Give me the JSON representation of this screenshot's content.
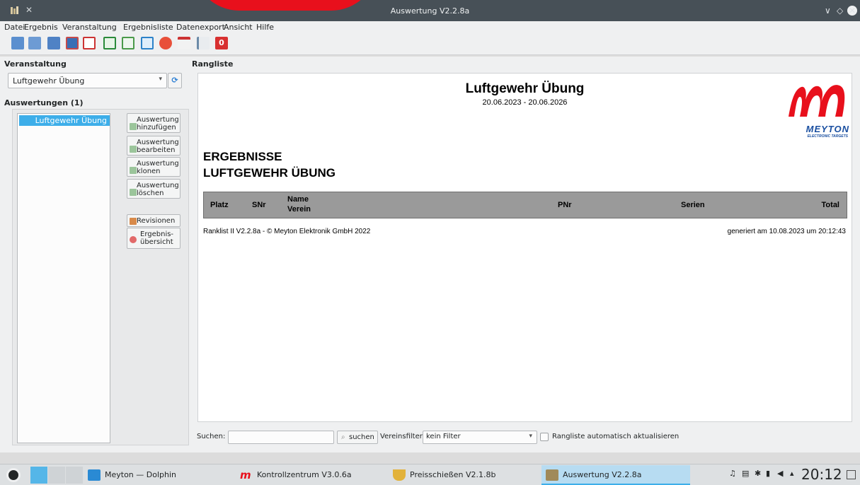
{
  "window": {
    "title": "Auswertung V2.2.8a"
  },
  "menu": [
    "Datei",
    "Ergebnis",
    "Veranstaltung",
    "Ergebnisliste",
    "Datenexport",
    "Ansicht",
    "Hilfe"
  ],
  "toolbar_icons": [
    "print-icon",
    "print-preview-icon",
    "print-options-icon",
    "save-icon",
    "pdf-export-icon",
    "csv-export-icon",
    "html-export-icon",
    "reload-icon",
    "target-icon",
    "calendar-icon",
    "ranking-list-icon",
    "exit-icon"
  ],
  "left": {
    "veranstaltung_label": "Veranstaltung",
    "veranstaltung_value": "Luftgewehr Übung",
    "auswertungen_label": "Auswertungen (1)",
    "auswertungen_items": [
      "Luftgewehr Übung"
    ],
    "buttons": {
      "add": [
        "Auswertung",
        "hinzufügen"
      ],
      "edit": [
        "Auswertung",
        "bearbeiten"
      ],
      "clone": [
        "Auswertung",
        "klonen"
      ],
      "delete": [
        "Auswertung",
        "löschen"
      ],
      "revisions": "Revisionen",
      "overview": [
        "Ergebnis-",
        "übersicht"
      ]
    }
  },
  "rangliste": {
    "label": "Rangliste",
    "title": "Luftgewehr Übung",
    "date_range": "20.06.2023 - 20.06.2026",
    "heading1": "ERGEBNISSE",
    "heading2": "LUFTGEWEHR ÜBUNG",
    "columns": {
      "platz": "Platz",
      "snr": "SNr",
      "name": "Name",
      "verein": "Verein",
      "pnr": "PNr",
      "serien": "Serien",
      "total": "Total"
    },
    "footer_left": "Ranklist II V2.2.8a - © Meyton Elektronik GmbH 2022",
    "footer_right": "generiert am 10.08.2023 um 20:12:43",
    "logo_text": "MEYTON",
    "logo_sub": "ELECTRONIC TARGETS"
  },
  "filter": {
    "search_label": "Suchen:",
    "search_value": "",
    "search_button": "suchen",
    "vereinsfilter_label": "Vereinsfilter:",
    "vereinsfilter_value": "kein Filter",
    "auto_refresh_label": "Rangliste automatisch aktualisieren",
    "auto_refresh_checked": false
  },
  "taskbar": {
    "tasks": [
      "Meyton — Dolphin",
      "Kontrollzentrum V3.0.6a",
      "Preisschießen V2.1.8b",
      "Auswertung V2.2.8a"
    ],
    "clock": "20:12"
  },
  "colors": {
    "accent": "#3daee9",
    "brand_red": "#e8101c",
    "table_header": "#9a9a9a",
    "logo_blue": "#1a4fa0"
  }
}
